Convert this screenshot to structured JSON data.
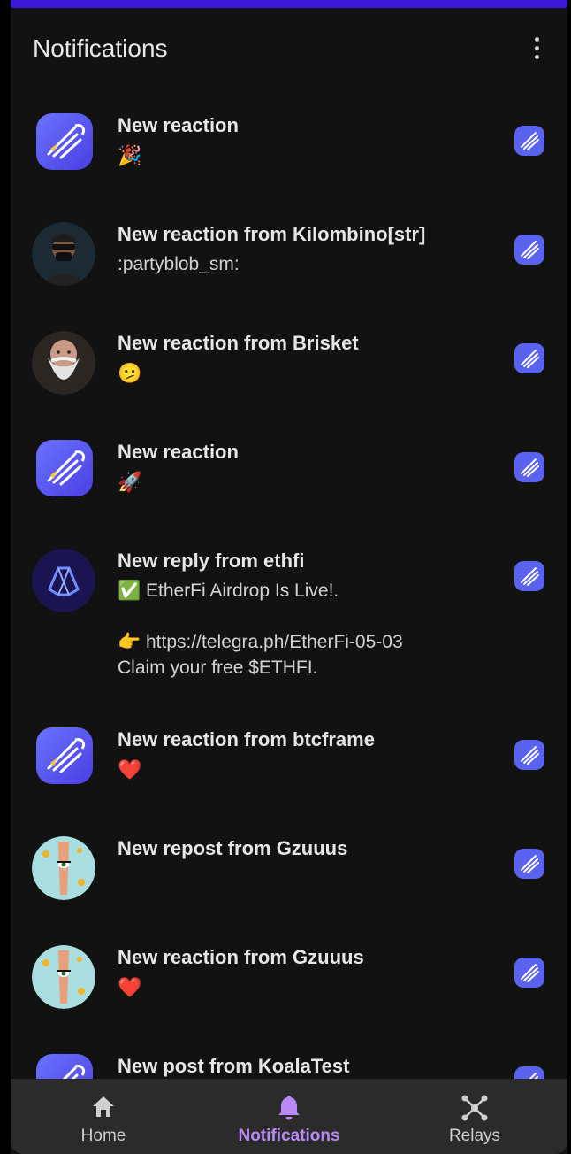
{
  "header": {
    "title": "Notifications"
  },
  "notifications": [
    {
      "title": "New reaction",
      "body": "🎉",
      "avatar": "app-logo"
    },
    {
      "title": "New reaction from Kilombino[str]",
      "body": ":partyblob_sm:",
      "avatar": "user-kilombino"
    },
    {
      "title": "New reaction from Brisket",
      "body": "🫤",
      "avatar": "user-brisket"
    },
    {
      "title": "New reaction",
      "body": "🚀",
      "avatar": "app-logo"
    },
    {
      "title": "New reply from ethfi",
      "body": "✅ EtherFi Airdrop Is Live!.\n\n👉 https://telegra.ph/EtherFi-05-03\nClaim your free $ETHFI.",
      "avatar": "user-ethfi"
    },
    {
      "title": "New reaction from btcframe",
      "body": "❤️",
      "avatar": "app-logo"
    },
    {
      "title": "New repost from Gzuuus",
      "body": "",
      "avatar": "user-gzuuus"
    },
    {
      "title": "New reaction from Gzuuus",
      "body": "❤️",
      "avatar": "user-gzuuus"
    },
    {
      "title": "New post from KoalaTest",
      "body": "",
      "avatar": "app-logo"
    }
  ],
  "nav": {
    "home": "Home",
    "notifications": "Notifications",
    "relays": "Relays"
  },
  "colors": {
    "accent": "#b888f5",
    "app_logo": "#5a63f0",
    "top_bar": "#3a1ad6"
  }
}
